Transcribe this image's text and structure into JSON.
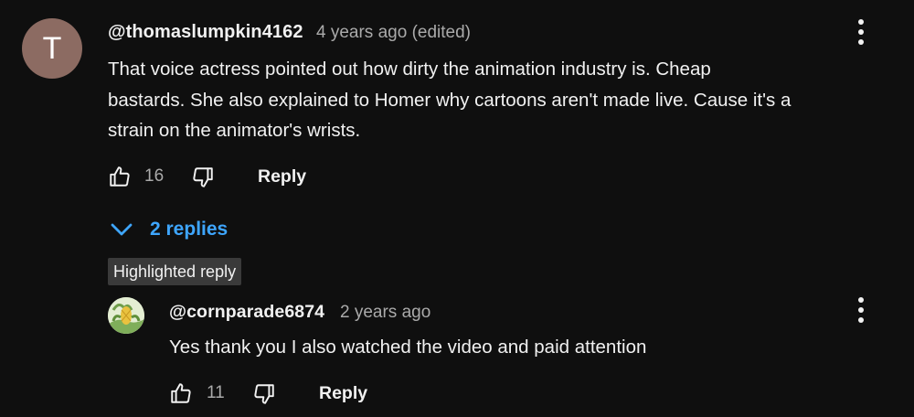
{
  "comment": {
    "avatar_letter": "T",
    "author": "@thomaslumpkin4162",
    "meta": "4 years ago (edited)",
    "text_lines": [
      "That voice actress pointed out how dirty the animation industry is. Cheap",
      "bastards. She also explained to Homer why cartoons aren't made live. Cause it's a",
      "strain on the animator's wrists."
    ],
    "likes": "16",
    "reply_label": "Reply"
  },
  "replies_toggle": {
    "label": "2 replies"
  },
  "highlighted": {
    "badge": "Highlighted reply"
  },
  "reply": {
    "author": "@cornparade6874",
    "meta": "2 years ago",
    "text": "Yes thank you I also watched the video and paid attention",
    "likes": "11",
    "reply_label": "Reply"
  },
  "colors": {
    "background": "#0f0f0f",
    "link_blue": "#3ea6ff",
    "meta_gray": "#aaaaaa",
    "avatar_brown": "#8c6b62"
  },
  "icons": [
    "more-vert-icon",
    "thumbs-up-icon",
    "thumbs-down-icon",
    "chevron-down-icon"
  ]
}
